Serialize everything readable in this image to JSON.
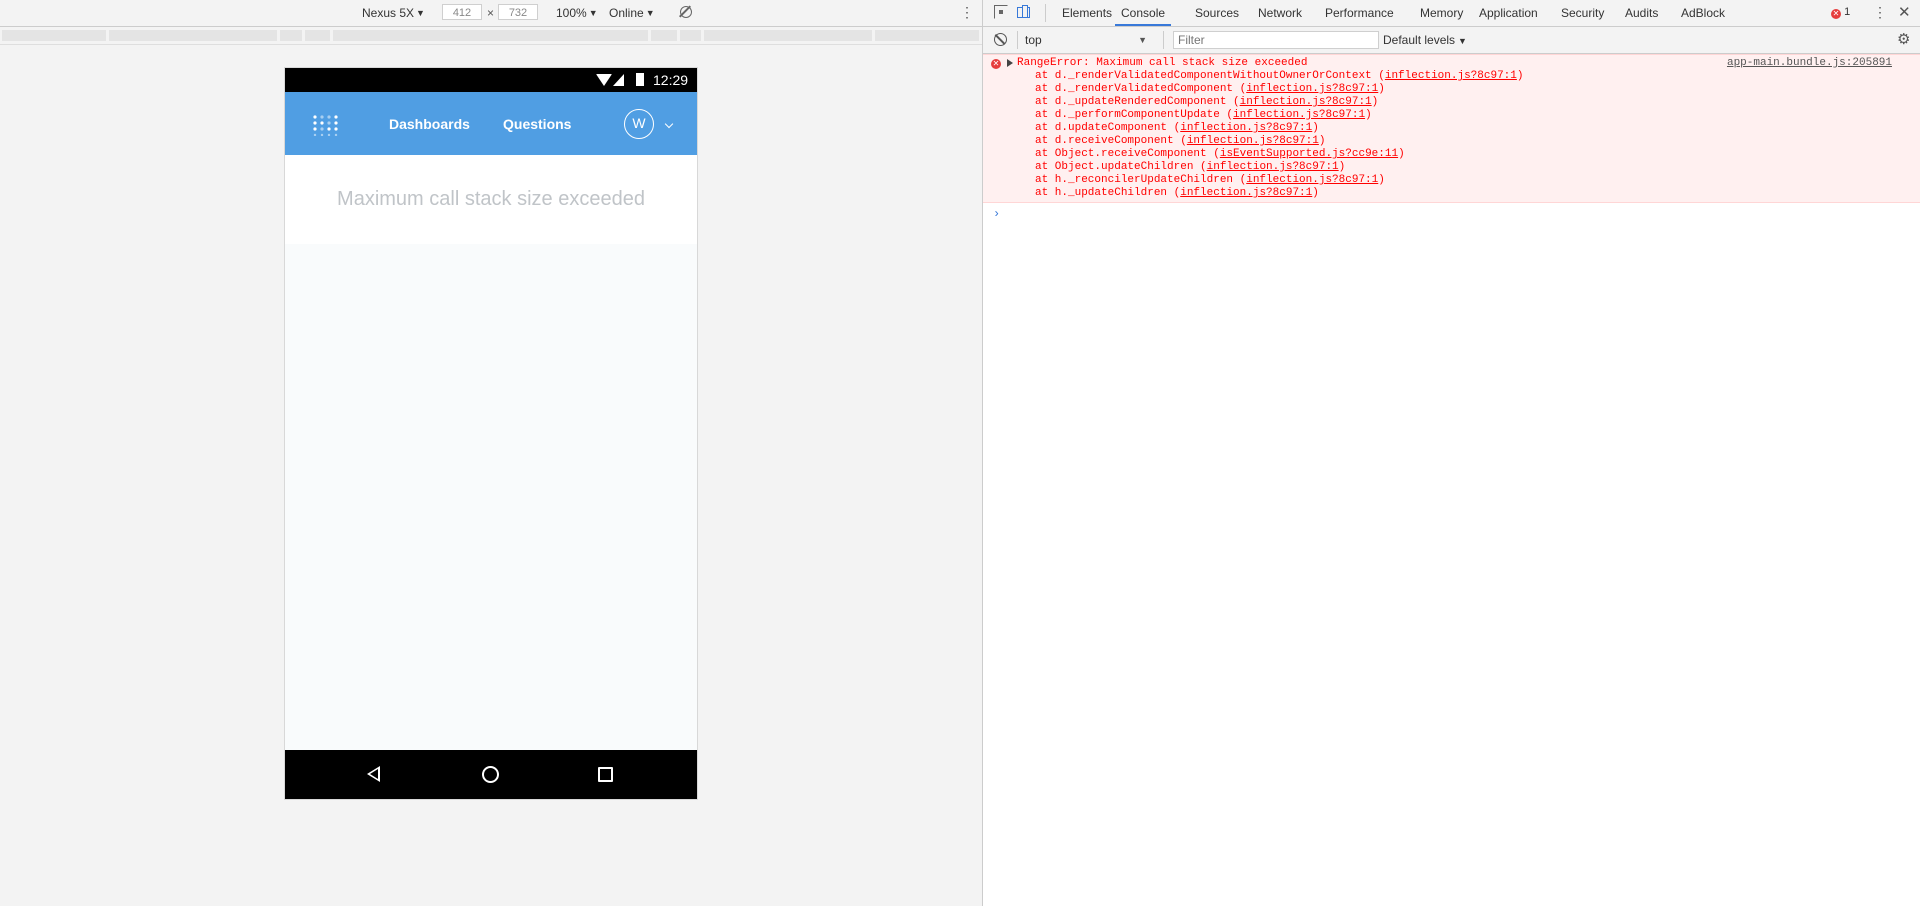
{
  "device_toolbar": {
    "device": "Nexus 5X",
    "width": "412",
    "height": "732",
    "times": "×",
    "zoom": "100%",
    "network": "Online"
  },
  "phone": {
    "time": "12:29",
    "nav": [
      "Dashboards",
      "Questions"
    ],
    "avatar_initial": "W",
    "error_message": "Maximum call stack size exceeded",
    "accent": "#509ee3"
  },
  "devtools": {
    "tabs": [
      "Elements",
      "Console",
      "Sources",
      "Network",
      "Performance",
      "Memory",
      "Application",
      "Security",
      "Audits",
      "AdBlock"
    ],
    "active_tab": "Console",
    "error_count": "1",
    "context": "top",
    "filter_placeholder": "Filter",
    "levels": "Default levels",
    "error": {
      "title": "RangeError: Maximum call stack size exceeded",
      "source": "app-main.bundle.js:205891",
      "stack": [
        {
          "fn": "at d._renderValidatedComponentWithoutOwnerOrContext (",
          "loc": "inflection.js?8c97:1",
          "end": ")"
        },
        {
          "fn": "at d._renderValidatedComponent (",
          "loc": "inflection.js?8c97:1",
          "end": ")"
        },
        {
          "fn": "at d._updateRenderedComponent (",
          "loc": "inflection.js?8c97:1",
          "end": ")"
        },
        {
          "fn": "at d._performComponentUpdate (",
          "loc": "inflection.js?8c97:1",
          "end": ")"
        },
        {
          "fn": "at d.updateComponent (",
          "loc": "inflection.js?8c97:1",
          "end": ")"
        },
        {
          "fn": "at d.receiveComponent (",
          "loc": "inflection.js?8c97:1",
          "end": ")"
        },
        {
          "fn": "at Object.receiveComponent (",
          "loc": "isEventSupported.js?cc9e:11",
          "end": ")"
        },
        {
          "fn": "at Object.updateChildren (",
          "loc": "inflection.js?8c97:1",
          "end": ")"
        },
        {
          "fn": "at h._reconcilerUpdateChildren (",
          "loc": "inflection.js?8c97:1",
          "end": ")"
        },
        {
          "fn": "at h._updateChildren (",
          "loc": "inflection.js?8c97:1",
          "end": ")"
        }
      ]
    },
    "prompt": "›"
  }
}
